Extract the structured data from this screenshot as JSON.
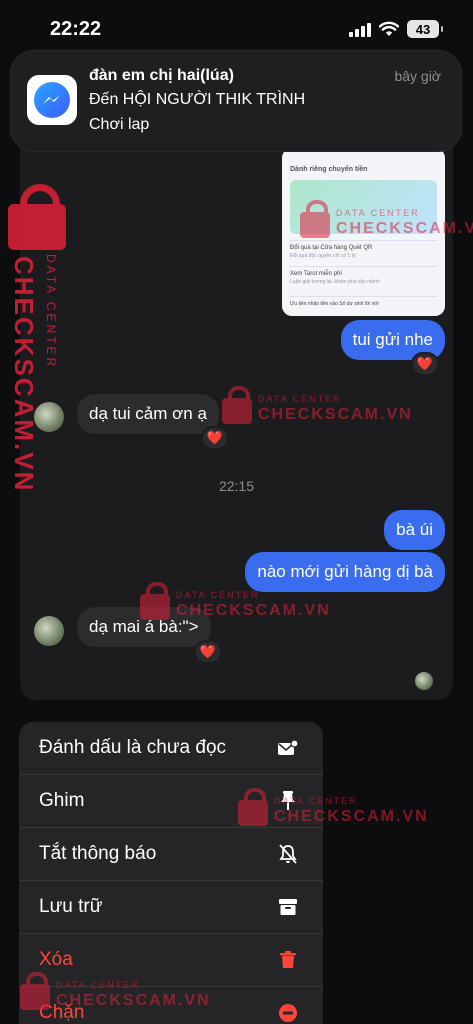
{
  "status_bar": {
    "time": "22:22",
    "battery": "43"
  },
  "notification": {
    "sender": "đàn em chị hai(lúa)",
    "time": "bây giờ",
    "group": "Đến HỘI NGƯỜI THIK TRÌNH",
    "body": "Chơi lap",
    "app_icon": "messenger-icon"
  },
  "chat": {
    "shared_image": {
      "title": "Dành riêng chuyển tiền",
      "row1": "Đổi quà tại Cửa hàng Quét QR",
      "row1_sub": "Đổi quà độc quyền chỉ có 1 lệ",
      "row2": "Xem Tarot miễn phí",
      "row2_sub": "Luận giải tương lai, khám phá vận mệnh",
      "footer": "Ưu tiên nhận tiền vào Số dư sinh lời với"
    },
    "messages": [
      {
        "side": "out",
        "text": "tui gửi nhe",
        "reaction": "❤️"
      },
      {
        "side": "in",
        "text": "dạ tui cảm ơn ạ",
        "reaction": "❤️"
      },
      {
        "side": "out",
        "text": "bà úi"
      },
      {
        "side": "out",
        "text": "nào mới gửi hàng dị bà"
      },
      {
        "side": "in",
        "text": "dạ mai á bà:\">",
        "reaction": "❤️"
      }
    ],
    "timestamp": "22:15"
  },
  "menu": {
    "items": [
      {
        "label": "Đánh dấu là chưa đọc",
        "icon": "mark-unread-icon",
        "danger": false
      },
      {
        "label": "Ghim",
        "icon": "pin-icon",
        "danger": false
      },
      {
        "label": "Tắt thông báo",
        "icon": "mute-bell-icon",
        "danger": false
      },
      {
        "label": "Lưu trữ",
        "icon": "archive-icon",
        "danger": false
      },
      {
        "label": "Xóa",
        "icon": "trash-icon",
        "danger": true
      },
      {
        "label": "Chặn",
        "icon": "block-icon",
        "danger": true
      }
    ]
  },
  "watermark": {
    "top": "DATA CENTER",
    "main": "CHECKSCAM.VN"
  },
  "colors": {
    "accent": "#3a6cf0",
    "danger": "#ff453a",
    "watermark": "#e0203a"
  }
}
